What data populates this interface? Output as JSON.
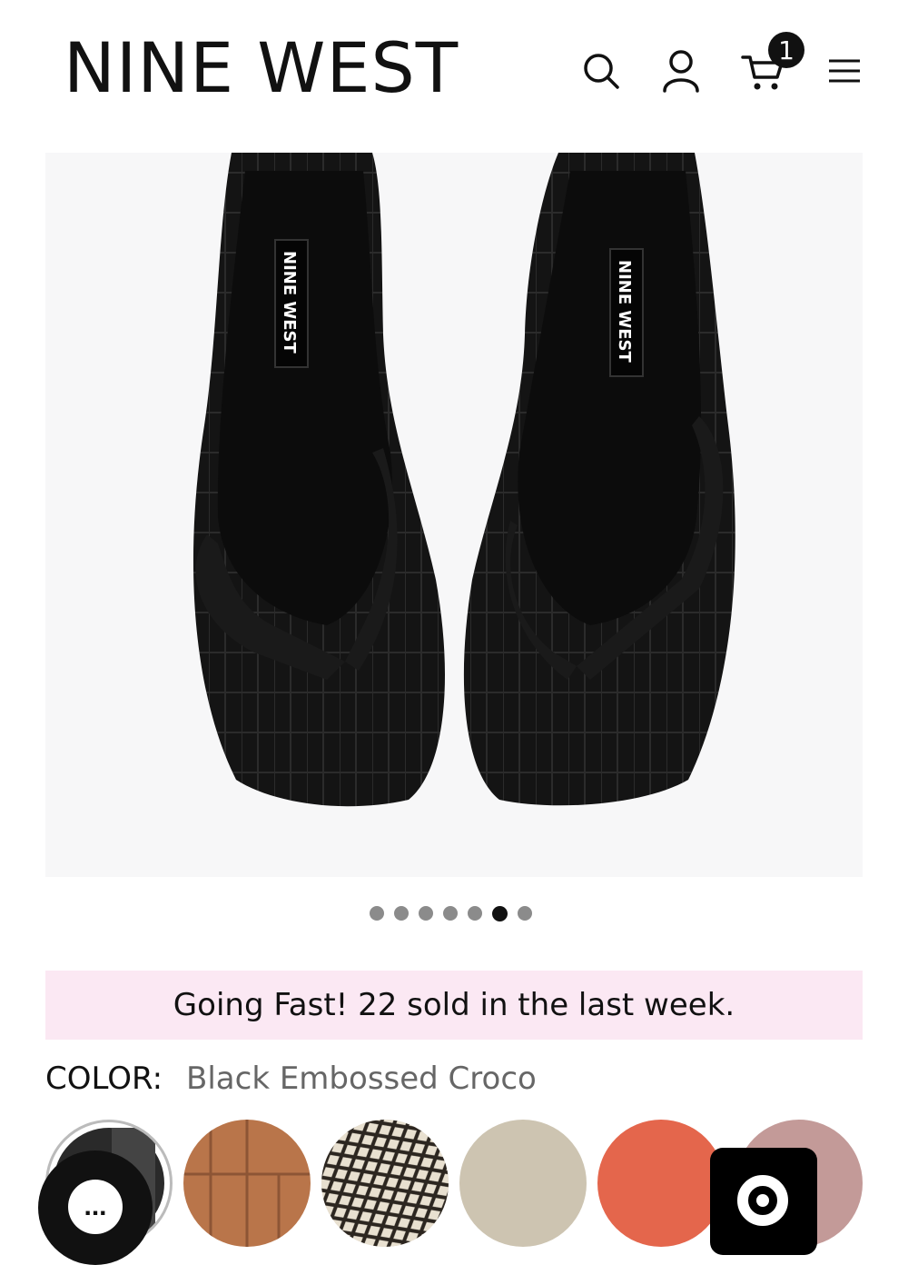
{
  "header": {
    "logo": "NINE WEST",
    "cart_count": "1",
    "icons": [
      "search-icon",
      "account-icon",
      "cart-icon",
      "menu-icon"
    ]
  },
  "product": {
    "image_alt": "Black croco-embossed thong sandals",
    "insole_brand": "NINE WEST",
    "carousel": {
      "total": 7,
      "active_index": 5
    }
  },
  "promo": {
    "text": "Going Fast! 22 sold in the last week."
  },
  "color": {
    "label": "COLOR:",
    "selected": "Black Embossed Croco",
    "swatches": [
      {
        "name": "black-croco",
        "color": "#2a2a2a",
        "selected": true
      },
      {
        "name": "brown-croco",
        "color": "#b9754a",
        "selected": false
      },
      {
        "name": "snake-print",
        "color": "#cfc3b0",
        "selected": false
      },
      {
        "name": "beige",
        "color": "#cdc4b1",
        "selected": false
      },
      {
        "name": "orange",
        "color": "#e4664c",
        "selected": false
      },
      {
        "name": "mauve",
        "color": "#c39a98",
        "selected": false
      }
    ]
  },
  "widgets": {
    "chat_icon": "chat-icon",
    "chat_text": "...",
    "help_icon": "help-icon"
  }
}
